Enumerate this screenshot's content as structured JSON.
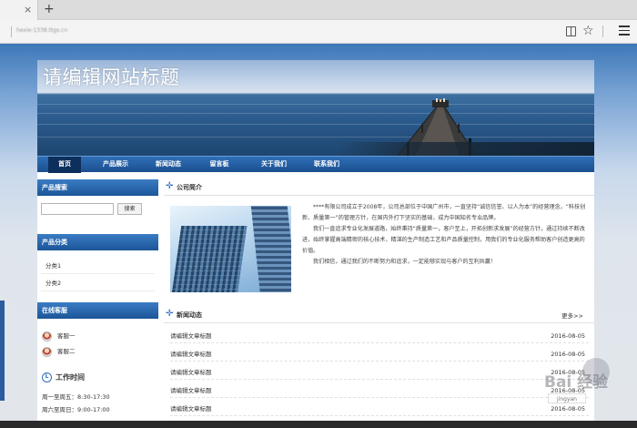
{
  "browser": {
    "tab_close": "×",
    "new_tab": "+",
    "address": "hexie-1338.ttgs.cn",
    "star": "☆"
  },
  "banner": {
    "title": "请编辑网站标题"
  },
  "nav": {
    "items": [
      "首页",
      "产品展示",
      "新闻动态",
      "留言板",
      "关于我们",
      "联系我们"
    ],
    "active_index": 0
  },
  "sidebar": {
    "search": {
      "title": "产品搜索",
      "button": "搜索",
      "value": ""
    },
    "categories": {
      "title": "产品分类",
      "items": [
        "分类1",
        "分类2"
      ]
    },
    "service": {
      "title": "在线客服",
      "items": [
        "客服一",
        "客服二"
      ]
    },
    "worktime": {
      "icon_char": "L",
      "title": "工作时间",
      "lines": [
        "周一至周五：8:30-17:30",
        "周六至周日：9:00-17:00"
      ]
    }
  },
  "about": {
    "title": "公司简介",
    "paragraphs": [
      "****有限公司成立于2008年，公司总部位于中国广州市，一直坚持“诚信信誉、以人为本”的经营理念，“科技创新、质量第一”的管理方针，在国内外打下坚实的基础，成为中国知名专业品牌。",
      "我们一直追求专业化发展道路，始终秉持“质量第一，客户至上，开拓创新求发展”的经营方针，通过持续不断改进，始终掌握高端精密的核心技术，精湛的生产制造工艺和产品质量控制，用我们的专业化服务帮助客户创造更高的价值。",
      "我们相信，通过我们的不断努力和追求，一定能够实现与客户的互利共赢！"
    ]
  },
  "news": {
    "title": "新闻动态",
    "more": "更多>>",
    "items": [
      {
        "title": "请编辑文章标题",
        "date": "2016-08-05"
      },
      {
        "title": "请编辑文章标题",
        "date": "2016-08-05"
      },
      {
        "title": "请编辑文章标题",
        "date": "2016-08-05"
      },
      {
        "title": "请编辑文章标题",
        "date": "2016-08-05"
      },
      {
        "title": "请编辑文章标题",
        "date": "2016-08-05"
      }
    ]
  },
  "watermark": {
    "text": "Bai 经验",
    "sub": "jingyan"
  },
  "colors": {
    "brand_blue": "#2f6fb7",
    "nav_active": "#0d2f5c"
  }
}
